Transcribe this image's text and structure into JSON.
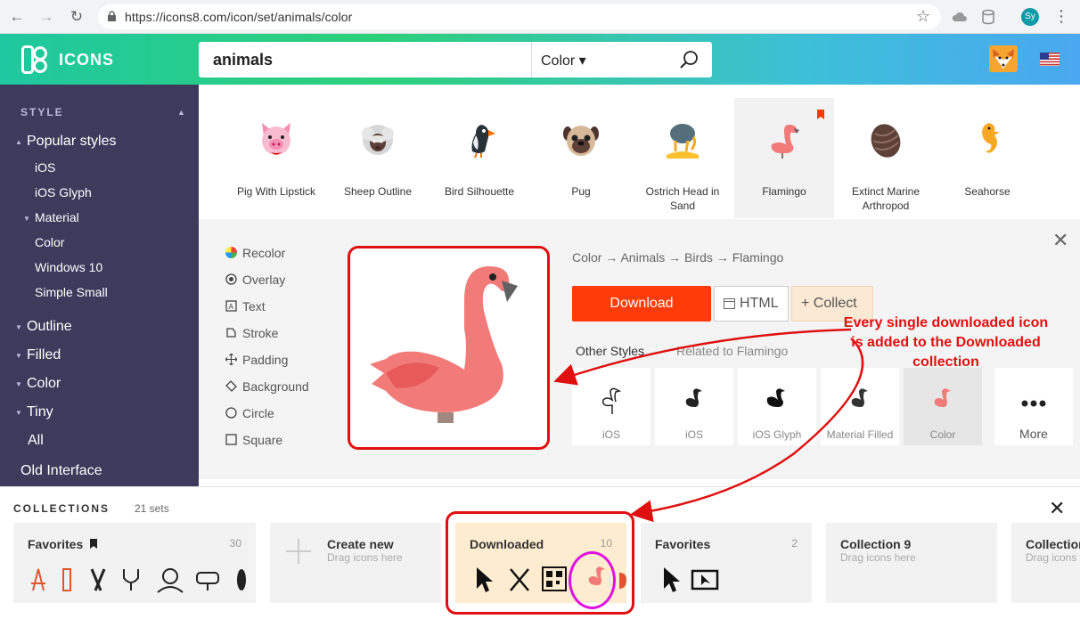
{
  "browser": {
    "url": "https://icons8.com/icon/set/animals/color",
    "profile_initials": "Sy"
  },
  "header": {
    "logo_text": "ICONS",
    "search_value": "animals",
    "style_select": "Color ▾"
  },
  "sidebar": {
    "section_title": "STYLE",
    "items": [
      {
        "label": "Popular styles"
      },
      {
        "label": "iOS"
      },
      {
        "label": "iOS Glyph"
      },
      {
        "label": "Material"
      },
      {
        "label": "Color"
      },
      {
        "label": "Windows 10"
      },
      {
        "label": "Simple Small"
      },
      {
        "label": "Outline"
      },
      {
        "label": "Filled"
      },
      {
        "label": "Color"
      },
      {
        "label": "Tiny"
      },
      {
        "label": "All"
      },
      {
        "label": "Old Interface"
      }
    ]
  },
  "icons": [
    {
      "label": "Pig With Lipstick"
    },
    {
      "label": "Sheep Outline"
    },
    {
      "label": "Bird Silhouette"
    },
    {
      "label": "Pug"
    },
    {
      "label": "Ostrich Head in Sand"
    },
    {
      "label": "Flamingo"
    },
    {
      "label": "Extinct Marine Arthropod"
    },
    {
      "label": "Seahorse"
    }
  ],
  "detail": {
    "options": [
      {
        "label": "Recolor"
      },
      {
        "label": "Overlay"
      },
      {
        "label": "Text"
      },
      {
        "label": "Stroke"
      },
      {
        "label": "Padding"
      },
      {
        "label": "Background"
      },
      {
        "label": "Circle"
      },
      {
        "label": "Square"
      }
    ],
    "breadcrumb": "Color → Animals → Birds → Flamingo",
    "download_label": "Download",
    "html_label": "HTML",
    "collect_label": "+ Collect",
    "tab_other": "Other Styles",
    "tab_related": "Related to Flamingo",
    "styles": [
      {
        "label": "iOS"
      },
      {
        "label": "iOS"
      },
      {
        "label": "iOS Glyph"
      },
      {
        "label": "Material Filled"
      },
      {
        "label": "Color"
      },
      {
        "label": "More"
      }
    ]
  },
  "annotation": "Every single downloaded icon is added to the Downloaded collection",
  "collections": {
    "title": "COLLECTIONS",
    "count": "21 sets",
    "cards": [
      {
        "name": "Favorites",
        "count": "30",
        "hint": ""
      },
      {
        "name": "Create new",
        "count": "",
        "hint": "Drag icons here"
      },
      {
        "name": "Downloaded",
        "count": "10",
        "hint": ""
      },
      {
        "name": "Favorites",
        "count": "2",
        "hint": ""
      },
      {
        "name": "Collection 9",
        "count": "",
        "hint": "Drag icons here"
      },
      {
        "name": "Collection",
        "count": "",
        "hint": "Drag icons here"
      }
    ]
  },
  "colors": {
    "accent": "#ff3b0a",
    "sidebar": "#3d3a5c",
    "annotation_red": "#e01010",
    "flamingo": "#f27a78"
  }
}
